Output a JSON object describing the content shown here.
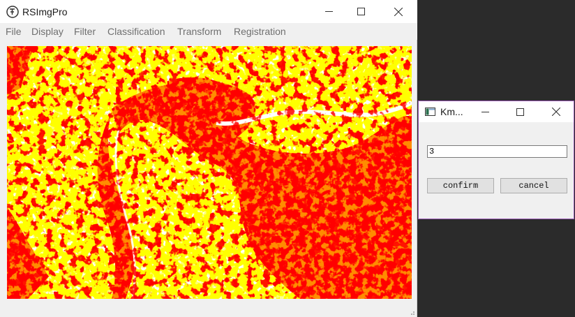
{
  "app": {
    "title": "RSImgPro",
    "icon": "app-logo-icon"
  },
  "window_controls": {
    "minimize": "—",
    "maximize": "☐",
    "close": "✕"
  },
  "menu": {
    "items": [
      "File",
      "Display",
      "Filter",
      "Classification",
      "Transform",
      "Registration"
    ]
  },
  "image_view": {
    "description_colors": {
      "class_1": "#ff0000",
      "class_2": "#ffff00",
      "class_3": "#ffffff"
    }
  },
  "dialog": {
    "title": "Km...",
    "icon": "window-icon",
    "input_value": "3",
    "confirm_label": "confirm",
    "cancel_label": "cancel"
  },
  "colors": {
    "desktop": "#2b2b2b",
    "window_bg": "#f0f0f0",
    "dialog_border": "#9b59b6"
  }
}
